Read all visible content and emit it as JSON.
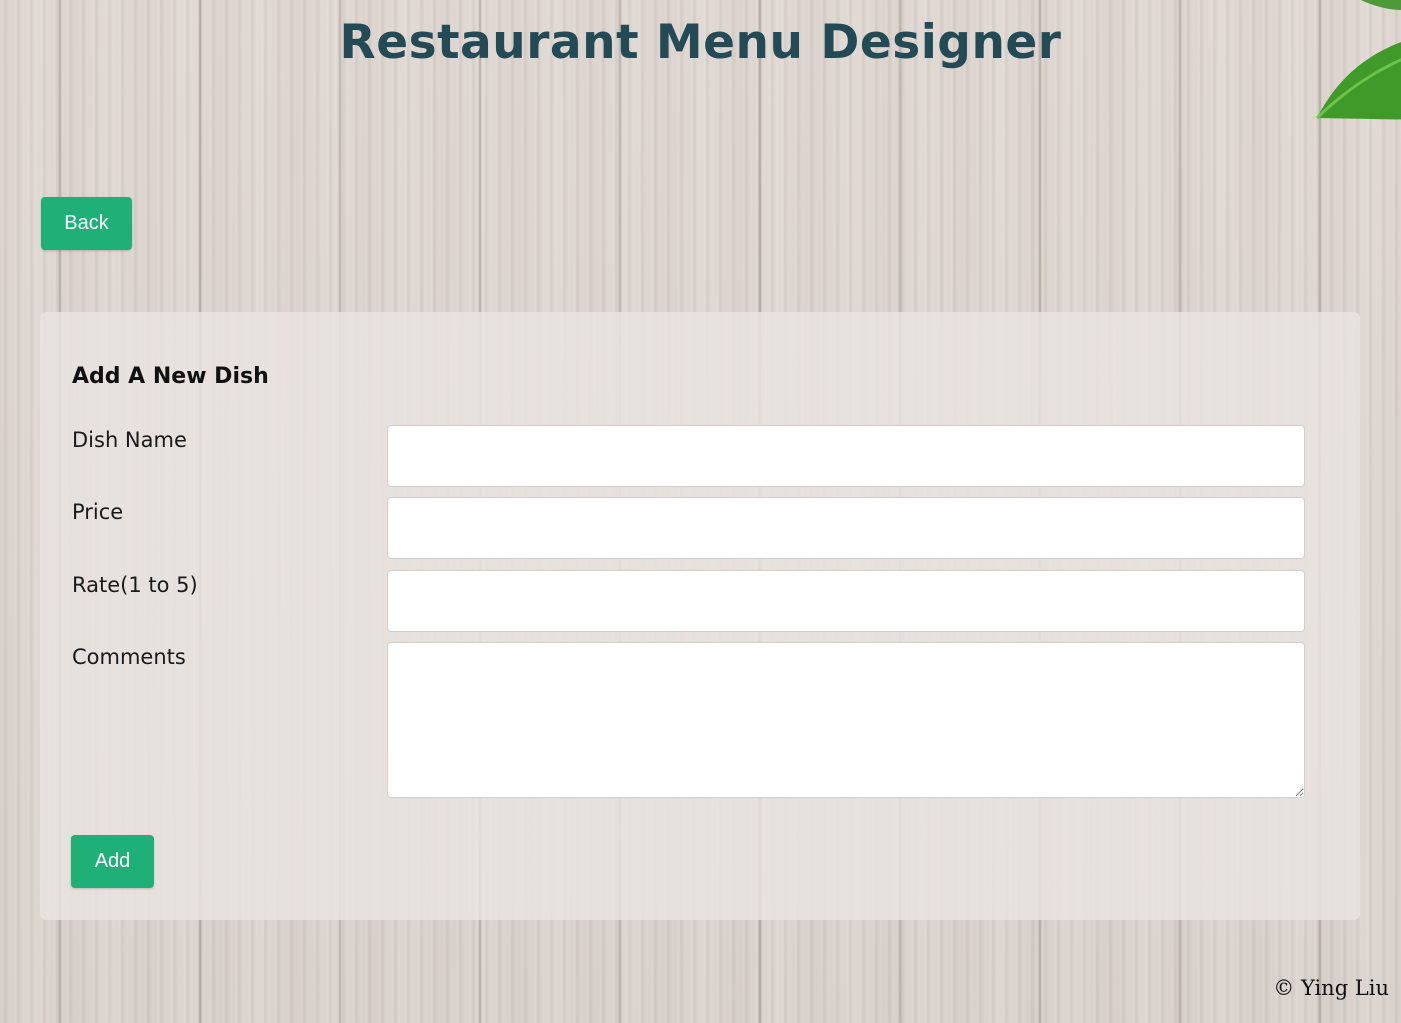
{
  "header": {
    "title": "Restaurant Menu Designer"
  },
  "nav": {
    "back_label": "Back"
  },
  "form": {
    "heading": "Add A New Dish",
    "fields": [
      {
        "label": "Dish Name",
        "value": ""
      },
      {
        "label": "Price",
        "value": ""
      },
      {
        "label": "Rate(1 to 5)",
        "value": ""
      },
      {
        "label": "Comments",
        "value": ""
      }
    ],
    "submit_label": "Add"
  },
  "footer": {
    "copyright": "© Ying Liu"
  },
  "colors": {
    "title": "#234a55",
    "button": "#1eb077",
    "leaf": "#3f9a2a"
  },
  "icons": {
    "decoration": "leaf-icon"
  }
}
